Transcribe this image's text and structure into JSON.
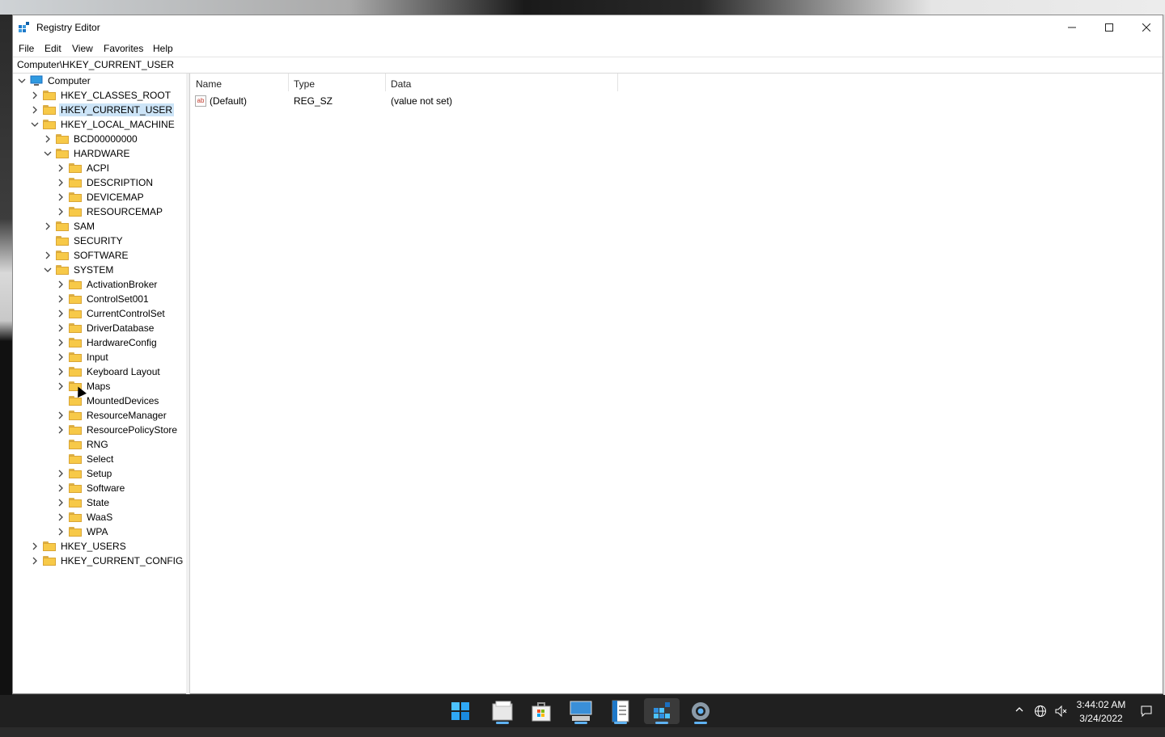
{
  "window": {
    "title": "Registry Editor"
  },
  "menu": [
    "File",
    "Edit",
    "View",
    "Favorites",
    "Help"
  ],
  "address": "Computer\\HKEY_CURRENT_USER",
  "tree": {
    "root": "Computer",
    "hives": [
      {
        "label": "HKEY_CLASSES_ROOT",
        "expanded": false
      },
      {
        "label": "HKEY_CURRENT_USER",
        "expanded": false,
        "selected": true
      },
      {
        "label": "HKEY_LOCAL_MACHINE",
        "expanded": true,
        "children": [
          {
            "label": "BCD00000000"
          },
          {
            "label": "HARDWARE",
            "expanded": true,
            "children": [
              "ACPI",
              "DESCRIPTION",
              "DEVICEMAP",
              "RESOURCEMAP"
            ]
          },
          {
            "label": "SAM"
          },
          {
            "label": "SECURITY"
          },
          {
            "label": "SOFTWARE"
          },
          {
            "label": "SYSTEM",
            "expanded": true,
            "children": [
              "ActivationBroker",
              "ControlSet001",
              "CurrentControlSet",
              "DriverDatabase",
              "HardwareConfig",
              "Input",
              "Keyboard Layout",
              "Maps",
              "MountedDevices",
              "ResourceManager",
              "ResourcePolicyStore",
              "RNG",
              "Select",
              "Setup",
              "Software",
              "State",
              "WaaS",
              "WPA"
            ]
          }
        ]
      },
      {
        "label": "HKEY_USERS",
        "expanded": false
      },
      {
        "label": "HKEY_CURRENT_CONFIG",
        "expanded": false
      }
    ]
  },
  "values": {
    "columns": [
      "Name",
      "Type",
      "Data"
    ],
    "rows": [
      {
        "name": "(Default)",
        "type": "REG_SZ",
        "data": "(value not set)"
      }
    ]
  },
  "taskbar": {
    "apps": [
      "start",
      "file-explorer",
      "microsoft-store",
      "remote-desktop",
      "notepad",
      "registry-editor",
      "settings"
    ],
    "active_app": "registry-editor"
  },
  "clock": {
    "time": "3:44:02 AM",
    "date": "3/24/2022"
  },
  "colors": {
    "selection": "#cce4f7",
    "folder": "#f7c948",
    "taskbar": "#202020",
    "accent": "#5fb2f2"
  }
}
